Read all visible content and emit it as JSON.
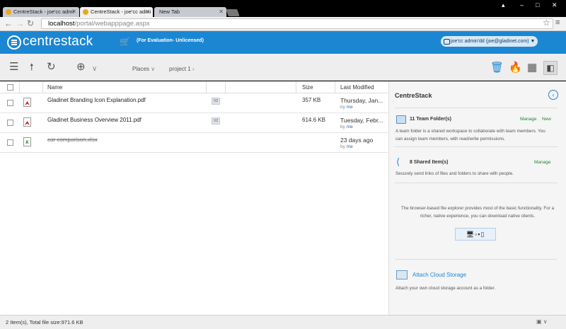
{
  "browser": {
    "tabs": [
      {
        "label": "CentreStack - joe'cc admi"
      },
      {
        "label": "CentreStack - joe'cc admi"
      },
      {
        "label": "New Tab"
      }
    ],
    "url_host": "localhost",
    "url_path": "/portal/webapppage.aspx"
  },
  "header": {
    "logo": "centrestack",
    "eval_note": "(For Evaluation- Unlicensed)",
    "user": "joe'cc admin'dd  (joe@gladinet.com)  ▼"
  },
  "toolbar": {
    "places_label": "Places",
    "breadcrumb": "project 1"
  },
  "file_list": {
    "columns": [
      "Name",
      "Size",
      "Last Modified"
    ],
    "rows": [
      {
        "name": "Gladinet Branding Icon Explanation.pdf",
        "version": "V2",
        "size": "357 KB",
        "modified": "Thursday, Jan...",
        "by_prefix": "by",
        "by_user": "me"
      },
      {
        "name": "Gladinet Business Overview 2011.pdf",
        "version": "V2",
        "size": "614.6 KB",
        "modified": "Tuesday, Febr...",
        "by_prefix": "by",
        "by_user": "me"
      },
      {
        "name": "car comparison.xlsx",
        "version": "",
        "size": "",
        "modified": "23 days ago",
        "by_prefix": "by",
        "by_user": "me"
      }
    ]
  },
  "side_panel": {
    "title": "CentreStack",
    "team_folders": {
      "title": "11 Team Folder(s)",
      "manage": "Manage",
      "new": "New",
      "desc_line1": "A team folder is a shared workspace to collaborate with team members. You",
      "desc_line2": "can assign team members, with read/write permissions."
    },
    "shared_items": {
      "title": "8 Shared Item(s)",
      "manage": "Manage",
      "desc": "Securely send links of files and folders to share with people."
    },
    "client_note_line1": "The browser-based file explorer provides most of the basic functionality. For a",
    "client_note_line2": "richer, native experience, you can download native clients.",
    "attach": {
      "title": "Attach Cloud Storage",
      "desc": "Attach your own cloud storage account as a folder."
    }
  },
  "status": {
    "text": "2 Item(s), Total file size:971.6 KB"
  }
}
